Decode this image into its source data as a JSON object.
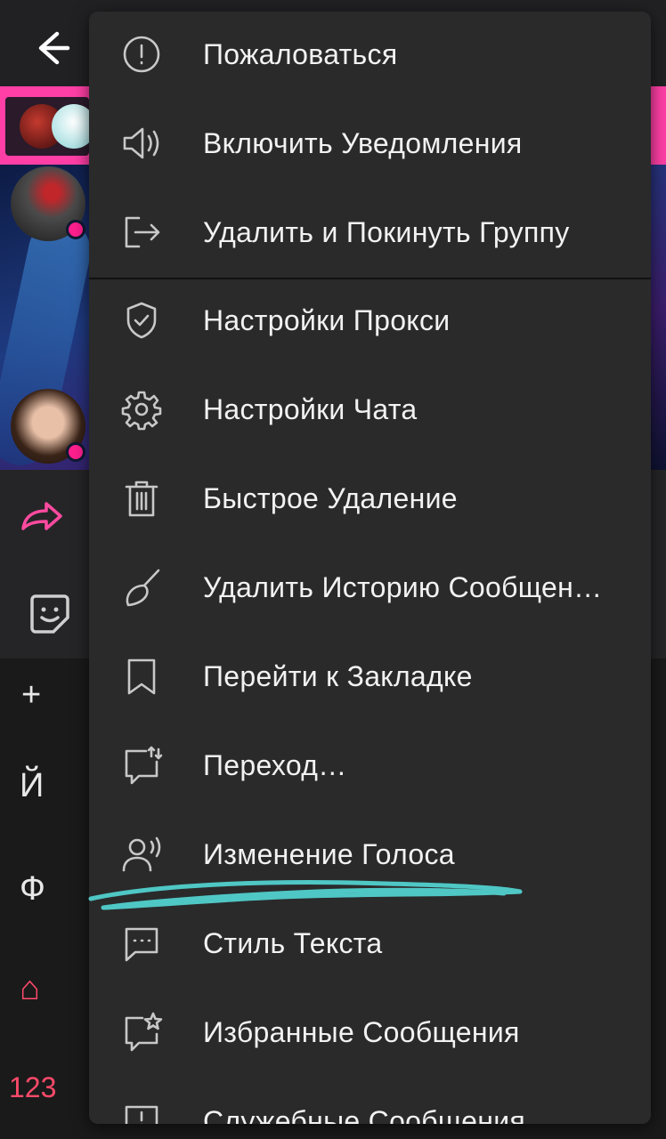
{
  "app": {
    "keyboard_keys": [
      "+",
      "Й",
      "Ф",
      "⌂",
      "123"
    ],
    "colors": {
      "accent_pink": "#ff3fa6",
      "menu_bg": "#2a2a2b",
      "annotation": "#4fc7c5"
    }
  },
  "menu": {
    "items": [
      {
        "label": "Пожаловаться",
        "icon": "report-icon"
      },
      {
        "label": "Включить Уведомления",
        "icon": "speaker-icon"
      },
      {
        "label": "Удалить и Покинуть Группу",
        "icon": "leave-icon"
      },
      {
        "label": "Настройки Прокси",
        "icon": "shield-icon"
      },
      {
        "label": "Настройки Чата",
        "icon": "gear-icon"
      },
      {
        "label": "Быстрое Удаление",
        "icon": "trash-icon"
      },
      {
        "label": "Удалить Историю Сообщен…",
        "icon": "broom-icon"
      },
      {
        "label": "Перейти к Закладке",
        "icon": "bookmark-icon"
      },
      {
        "label": "Переход…",
        "icon": "message-transfer-icon"
      },
      {
        "label": "Изменение Голоса",
        "icon": "voice-change-icon"
      },
      {
        "label": "Стиль Текста",
        "icon": "text-style-icon"
      },
      {
        "label": "Избранные Сообщения",
        "icon": "starred-message-icon"
      },
      {
        "label": "Служебные Сообщения",
        "icon": "service-message-icon"
      }
    ]
  }
}
